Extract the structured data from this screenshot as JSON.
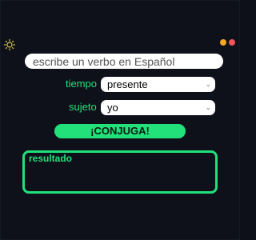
{
  "theme": {
    "background": "#0e111a",
    "accent": "#22e07a",
    "toggle_icon": "sun-icon"
  },
  "window_controls": {
    "dots": [
      {
        "name": "minimize-dot",
        "color": "#f5a623"
      },
      {
        "name": "close-dot",
        "color": "#f25555"
      }
    ]
  },
  "verb_input": {
    "placeholder": "escribe un verbo en Español",
    "value": ""
  },
  "tense": {
    "label": "tiempo",
    "selected": "presente"
  },
  "subject": {
    "label": "sujeto",
    "selected": "yo"
  },
  "conjugate_button": {
    "label": "¡CONJUGA!"
  },
  "result": {
    "label": "resultado"
  }
}
